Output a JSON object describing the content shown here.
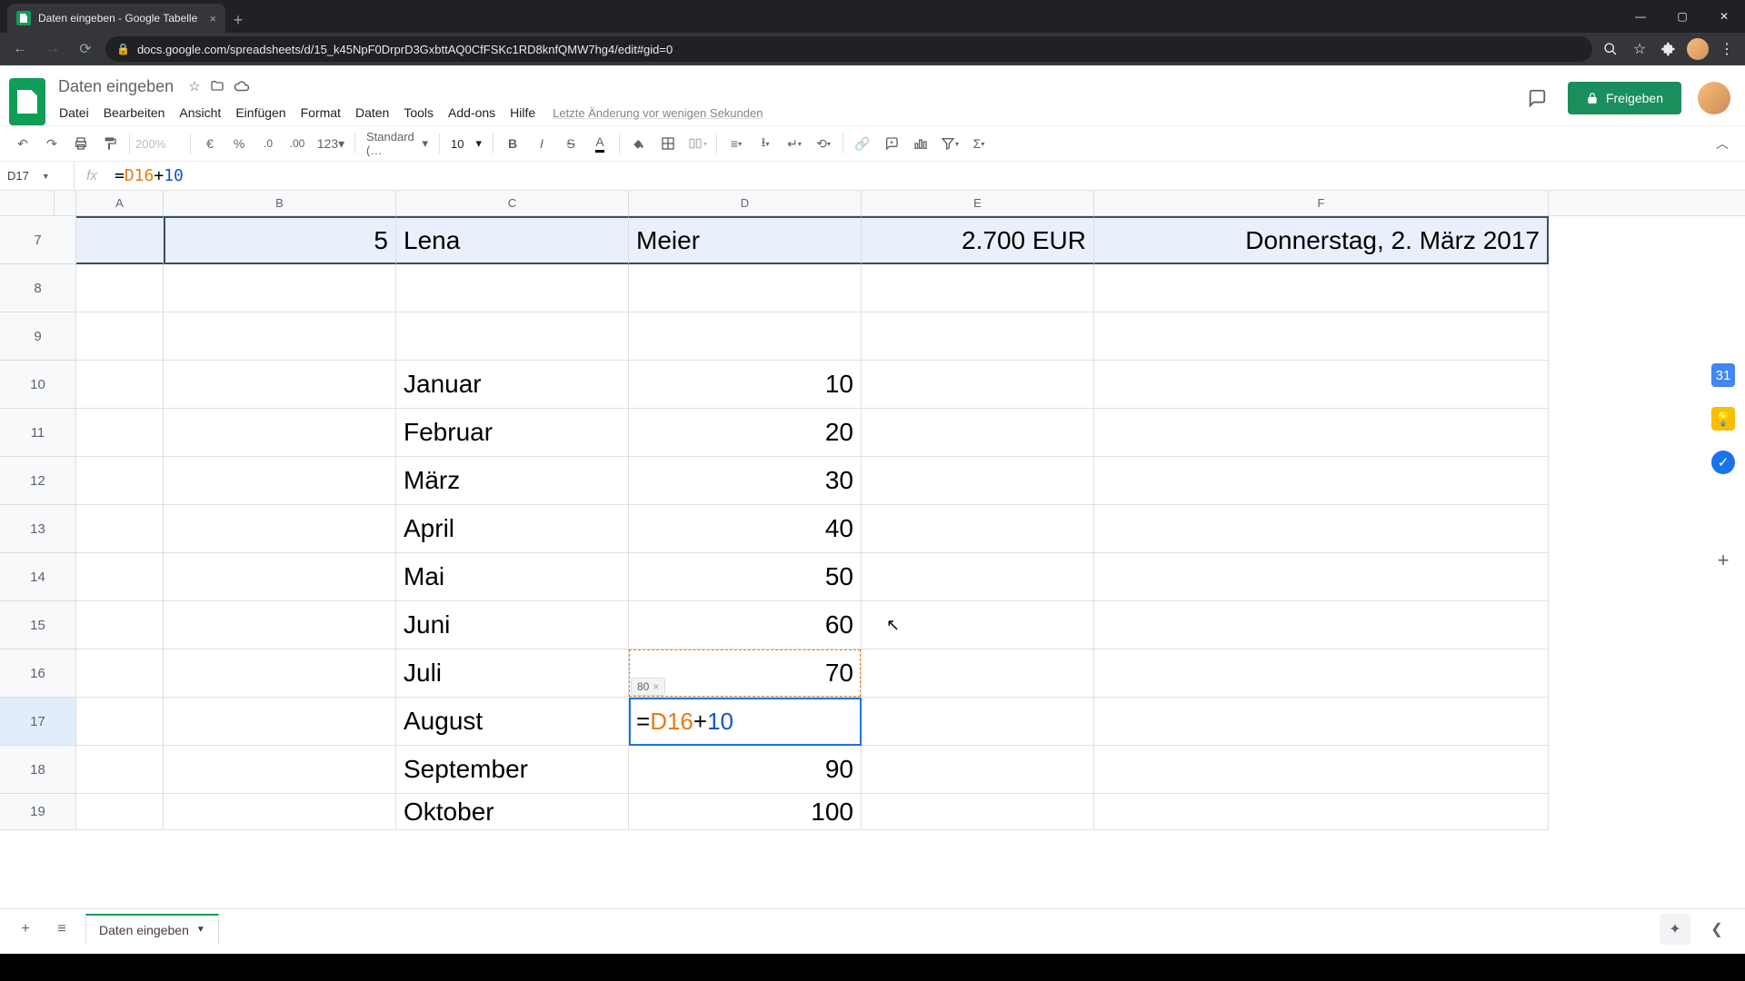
{
  "browser": {
    "tab_title": "Daten eingeben - Google Tabelle",
    "url": "docs.google.com/spreadsheets/d/15_k45NpF0DrprD3GxbttAQ0CfFSKc1RD8knfQMW7hg4/edit#gid=0"
  },
  "doc": {
    "title": "Daten eingeben",
    "menus": [
      "Datei",
      "Bearbeiten",
      "Ansicht",
      "Einfügen",
      "Format",
      "Daten",
      "Tools",
      "Add-ons",
      "Hilfe"
    ],
    "last_edit": "Letzte Änderung vor wenigen Sekunden",
    "share_label": "Freigeben"
  },
  "toolbar": {
    "zoom": "200%",
    "currency": "€",
    "percent": "%",
    "dec_less": ".0",
    "dec_more": ".00",
    "num123": "123",
    "format_name": "Standard (…",
    "font_size": "10"
  },
  "namebox": "D17",
  "formula": {
    "eq": "=",
    "ref": "D16",
    "op": "+",
    "num": "10"
  },
  "columns": [
    "A",
    "B",
    "C",
    "D",
    "E",
    "F"
  ],
  "row_labels": [
    "7",
    "8",
    "9",
    "10",
    "11",
    "12",
    "13",
    "14",
    "15",
    "16",
    "17",
    "18",
    "19"
  ],
  "row7": {
    "B": "5",
    "C": "Lena",
    "D": "Meier",
    "E": "2.700 EUR",
    "F": "Donnerstag, 2. März 2017"
  },
  "months": {
    "r10": {
      "C": "Januar",
      "D": "10"
    },
    "r11": {
      "C": "Februar",
      "D": "20"
    },
    "r12": {
      "C": "März",
      "D": "30"
    },
    "r13": {
      "C": "April",
      "D": "40"
    },
    "r14": {
      "C": "Mai",
      "D": "50"
    },
    "r15": {
      "C": "Juni",
      "D": "60"
    },
    "r16": {
      "C": "Juli",
      "D": "70"
    },
    "r17": {
      "C": "August"
    },
    "r18": {
      "C": "September",
      "D": "90"
    },
    "r19": {
      "C": "Oktober",
      "D": "100"
    }
  },
  "edit_cell": {
    "eq": "=",
    "ref": "D16",
    "op": "+",
    "num": "10",
    "result_preview": "80"
  },
  "footer": {
    "sheet_name": "Daten eingeben"
  }
}
